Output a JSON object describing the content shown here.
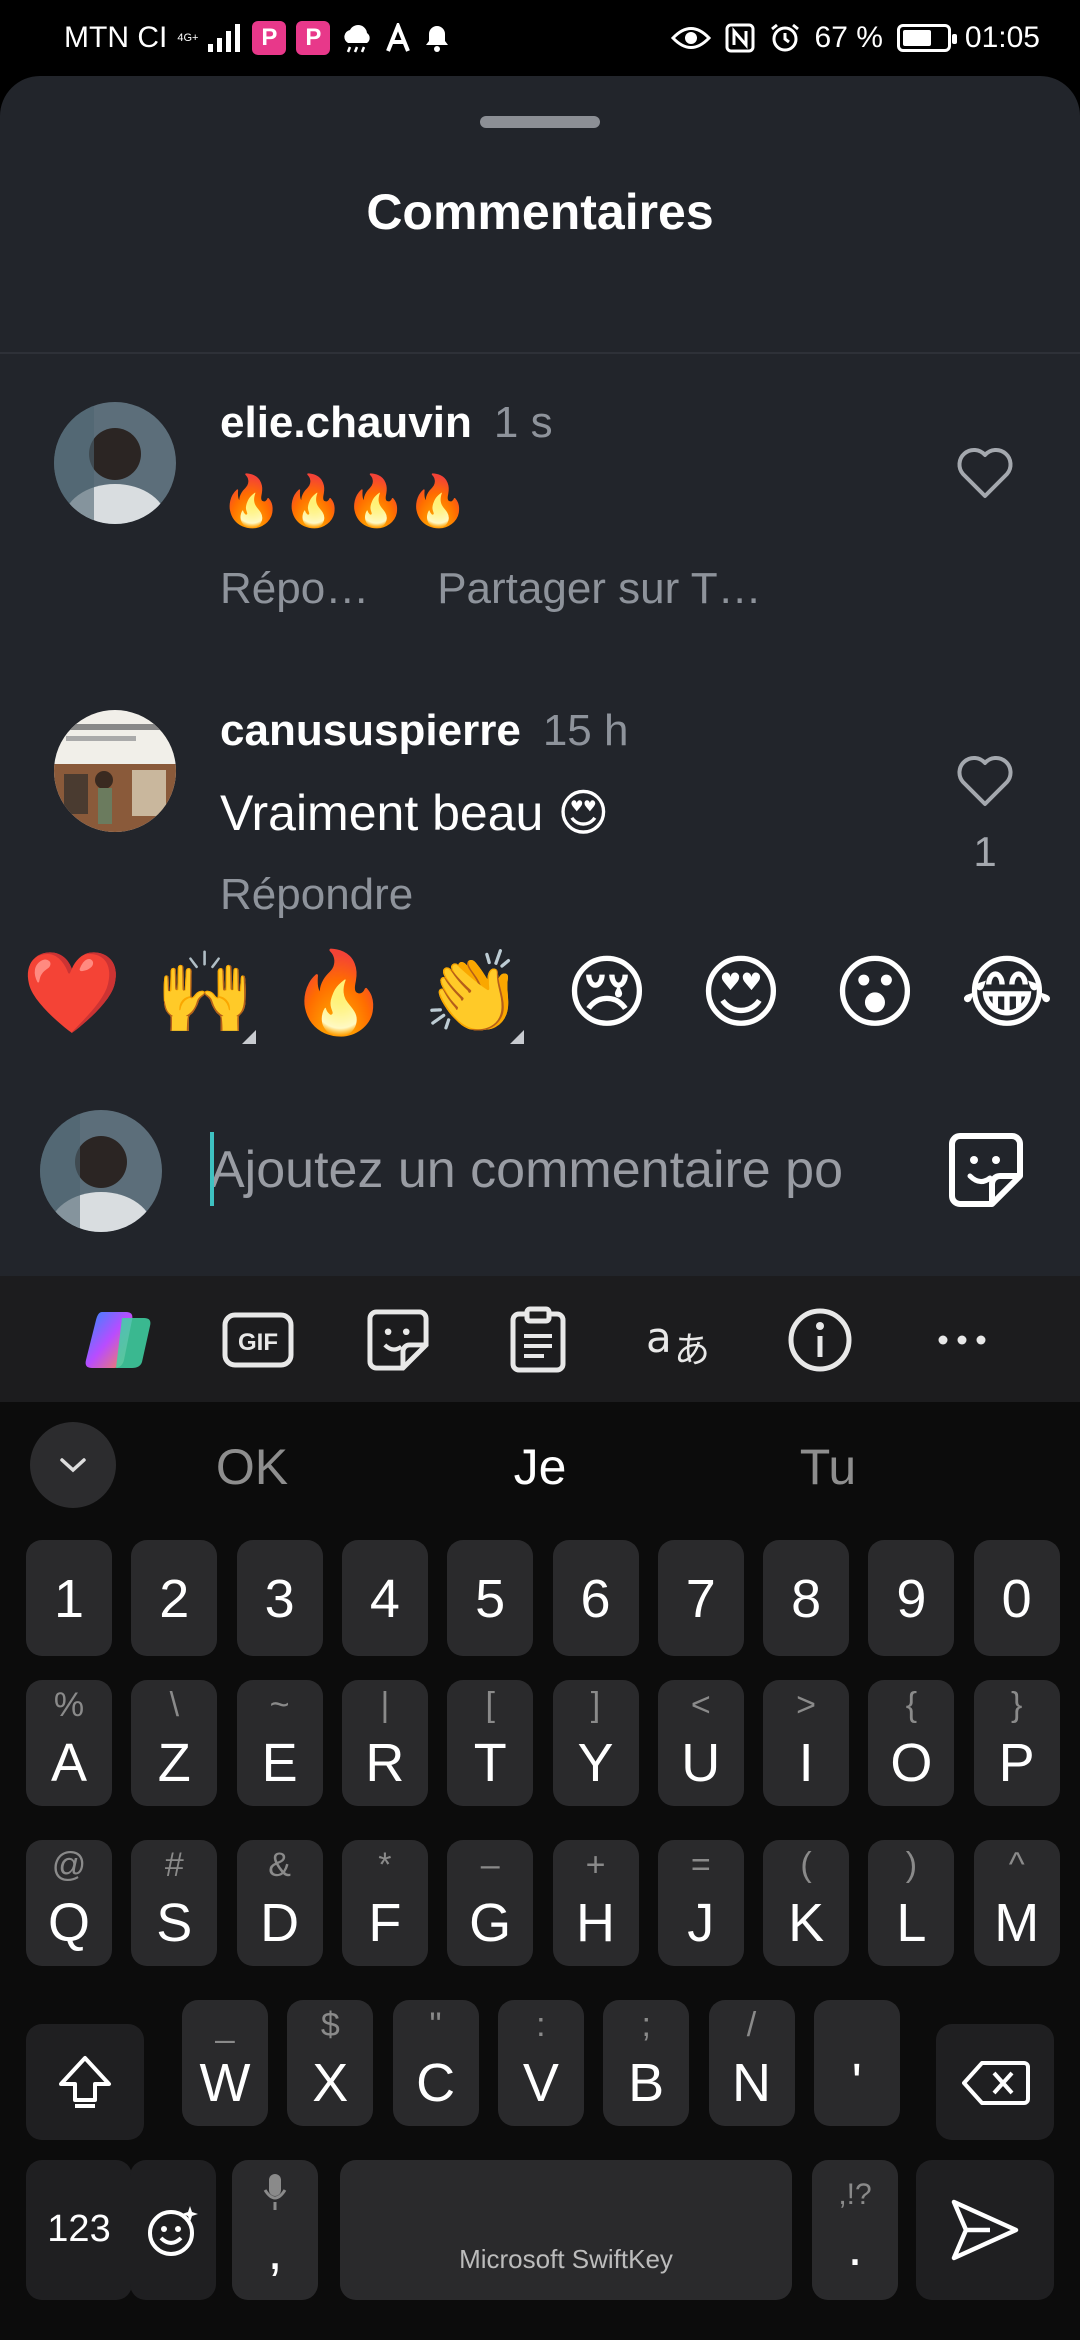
{
  "status_bar": {
    "carrier": "MTN CI",
    "network": "4G+",
    "battery": "67 %",
    "battery_level": 0.67,
    "time": "01:05"
  },
  "sheet": {
    "title": "Commentaires"
  },
  "comments": [
    {
      "username": "elie.chauvin",
      "time": "1 s",
      "text": "🔥🔥🔥🔥",
      "actions": [
        "Répo…",
        "Partager sur T…"
      ],
      "likes": ""
    },
    {
      "username": "canususpierre",
      "time": "15 h",
      "text": "Vraiment  beau 😍",
      "actions": [
        "Répondre"
      ],
      "likes": "1"
    }
  ],
  "emoji_bar": [
    "❤️",
    "🙌",
    "🔥",
    "👏",
    "😢",
    "😍",
    "😮",
    "😂"
  ],
  "comment_input": {
    "placeholder": "Ajoutez un commentaire po"
  },
  "keyboard_toolbar": [
    "copilot-icon",
    "gif-icon",
    "sticker-icon",
    "clipboard-icon",
    "translate-icon",
    "info-icon",
    "more-icon"
  ],
  "keyboard": {
    "suggestions": [
      "OK",
      "Je",
      "Tu"
    ],
    "number_row": [
      "1",
      "2",
      "3",
      "4",
      "5",
      "6",
      "7",
      "8",
      "9",
      "0"
    ],
    "row1": [
      {
        "k": "A",
        "s": "%"
      },
      {
        "k": "Z",
        "s": "\\"
      },
      {
        "k": "E",
        "s": "~"
      },
      {
        "k": "R",
        "s": "|"
      },
      {
        "k": "T",
        "s": "["
      },
      {
        "k": "Y",
        "s": "]"
      },
      {
        "k": "U",
        "s": "<"
      },
      {
        "k": "I",
        "s": ">"
      },
      {
        "k": "O",
        "s": "{"
      },
      {
        "k": "P",
        "s": "}"
      }
    ],
    "row2": [
      {
        "k": "Q",
        "s": "@"
      },
      {
        "k": "S",
        "s": "#"
      },
      {
        "k": "D",
        "s": "&"
      },
      {
        "k": "F",
        "s": "*"
      },
      {
        "k": "G",
        "s": "–"
      },
      {
        "k": "H",
        "s": "+"
      },
      {
        "k": "J",
        "s": "="
      },
      {
        "k": "K",
        "s": "("
      },
      {
        "k": "L",
        "s": ")"
      },
      {
        "k": "M",
        "s": "^"
      }
    ],
    "row3": [
      {
        "k": "W",
        "s": "_"
      },
      {
        "k": "X",
        "s": "$"
      },
      {
        "k": "C",
        "s": "\""
      },
      {
        "k": "V",
        "s": ":"
      },
      {
        "k": "B",
        "s": ";"
      },
      {
        "k": "N",
        "s": "/"
      },
      {
        "k": "'",
        "s": ""
      }
    ],
    "numbers_key": "123",
    "comma_key": ",",
    "period_key": ".",
    "period_sub": ",!?",
    "space_label": "Microsoft SwiftKey"
  }
}
